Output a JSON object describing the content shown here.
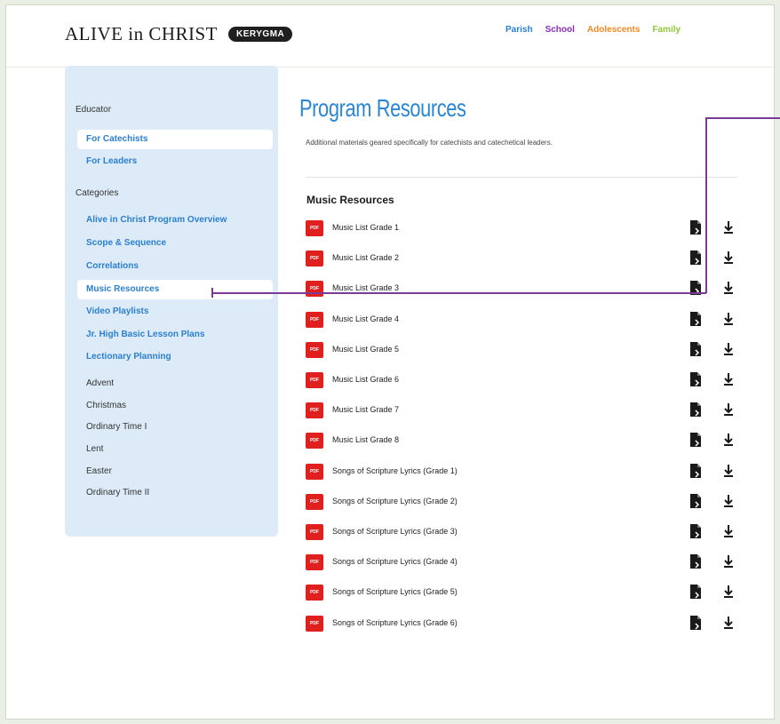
{
  "header": {
    "logo_text": "ALIVE in CHRIST",
    "logo_badge": "KERYGMA",
    "nav": [
      {
        "label": "Parish",
        "color": "#2a7fd0"
      },
      {
        "label": "School",
        "color": "#8a2bb5"
      },
      {
        "label": "Adolescents",
        "color": "#f08a24"
      },
      {
        "label": "Family",
        "color": "#8fc43a"
      }
    ]
  },
  "sidebar": {
    "educator_heading": "Educator",
    "educator_items": [
      "For Catechists",
      "For Leaders"
    ],
    "categories_heading": "Categories",
    "category_items": [
      "Alive in Christ Program Overview",
      "Scope & Sequence",
      "Correlations",
      "Music Resources",
      "Video Playlists",
      "Jr. High Basic Lesson Plans",
      "Lectionary Planning"
    ],
    "lectionary_sub_items": [
      "Advent",
      "Christmas",
      "Ordinary Time I",
      "Lent",
      "Easter",
      "Ordinary Time II"
    ]
  },
  "main": {
    "title": "Program Resources",
    "subtitle": "Additional materials geared specifically for catechists and catechetical leaders.",
    "section_title": "Music Resources",
    "pdf_label": "PDF",
    "files": [
      "Music List Grade 1",
      "Music List Grade 2",
      "Music List Grade 3",
      "Music List Grade 4",
      "Music List Grade 5",
      "Music List Grade 6",
      "Music List Grade 7",
      "Music List Grade 8",
      "Songs of Scripture Lyrics (Grade 1)",
      "Songs of Scripture Lyrics (Grade 2)",
      "Songs of Scripture Lyrics (Grade 3)",
      "Songs of Scripture Lyrics (Grade 4)",
      "Songs of Scripture Lyrics (Grade 5)",
      "Songs of Scripture Lyrics (Grade 6)"
    ]
  },
  "colors": {
    "accent_blue": "#2b86d4",
    "sidebar_bg": "#dcebf7",
    "pdf_red": "#e0201f",
    "callout_purple": "#7a3a96"
  }
}
